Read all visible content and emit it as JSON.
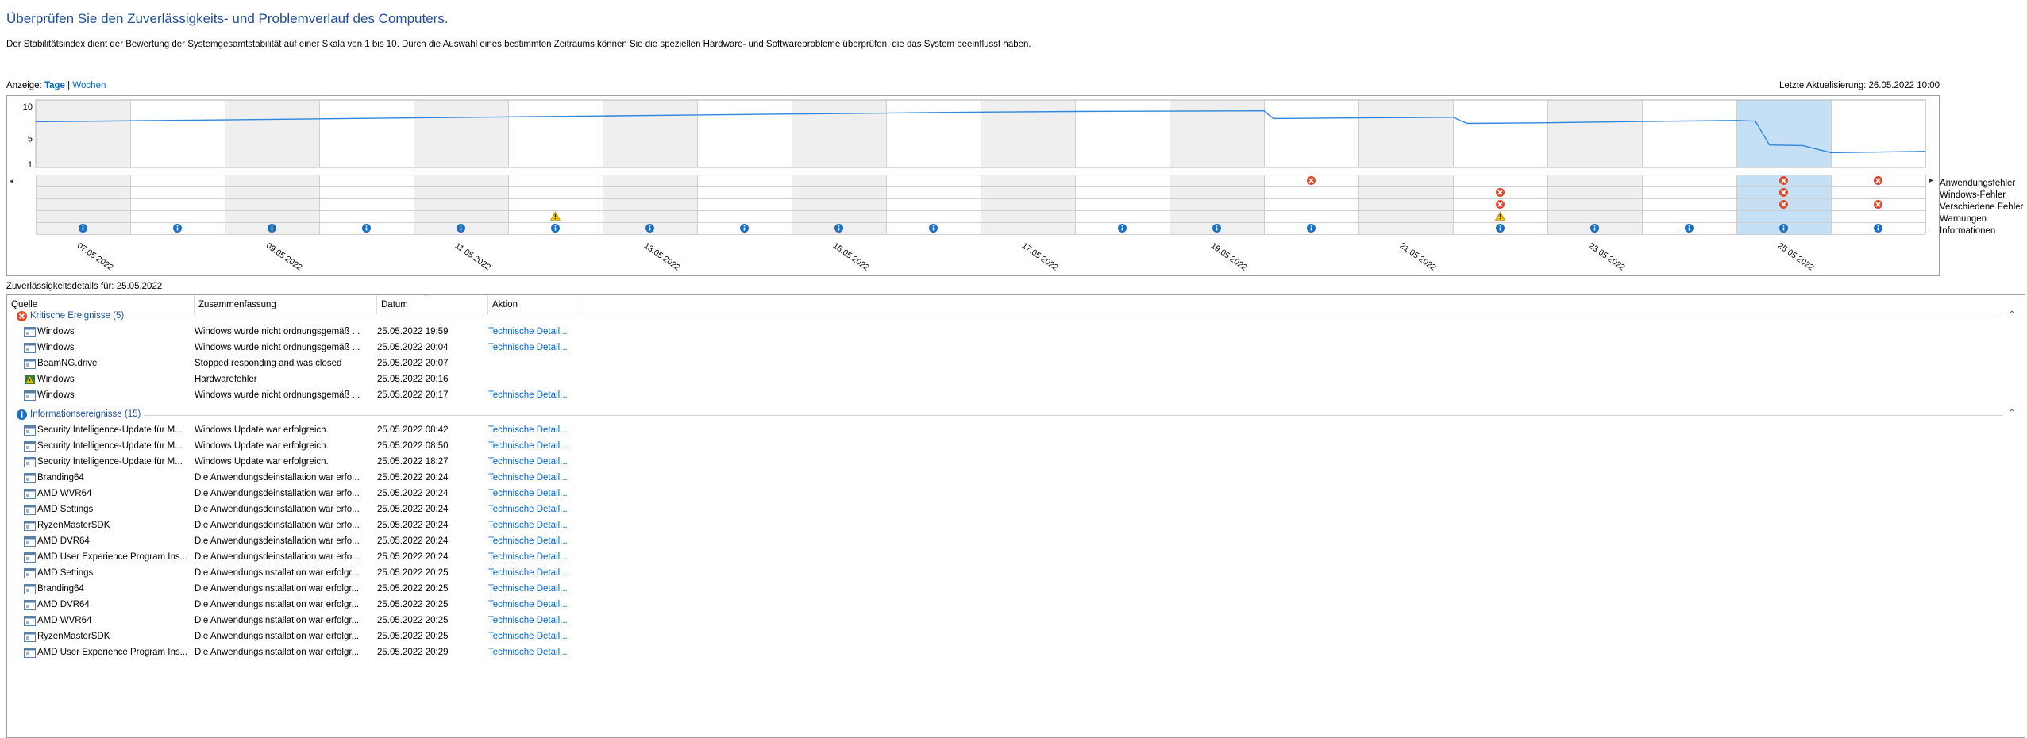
{
  "header": {
    "title": "Überprüfen Sie den Zuverlässigkeits- und Problemverlauf des Computers.",
    "description": "Der Stabilitätsindex dient der Bewertung der Systemgesamtstabilität auf einer Skala von 1 bis 10. Durch die Auswahl eines bestimmten Zeitraums können Sie die speziellen Hardware- und Softwareprobleme überprüfen, die das System beeinflusst haben.",
    "view_label": "Anzeige:",
    "view_days": "Tage",
    "view_separator": "|",
    "view_weeks": "Wochen",
    "last_update": "Letzte Aktualisierung: 26.05.2022 10:00"
  },
  "chart_data": {
    "type": "line",
    "y_ticks": [
      "10",
      "5",
      "1"
    ],
    "ylim": [
      1,
      10
    ],
    "x_labels": [
      "07.05.2022",
      "09.05.2022",
      "11.05.2022",
      "13.05.2022",
      "15.05.2022",
      "17.05.2022",
      "19.05.2022",
      "21.05.2022",
      "23.05.2022",
      "25.05.2022"
    ],
    "x_label_columns": [
      0,
      2,
      4,
      6,
      8,
      10,
      12,
      14,
      16,
      18
    ],
    "num_columns": 20,
    "selected_column": 18,
    "stability": {
      "x": [
        0,
        1,
        2,
        3,
        4,
        5,
        6,
        7,
        8,
        9,
        10,
        11,
        12,
        13,
        13.1,
        14,
        15,
        15.15,
        16,
        17,
        18,
        18.2,
        18.35,
        18.7,
        19,
        20
      ],
      "y": [
        7.6,
        7.75,
        7.9,
        8.05,
        8.2,
        8.35,
        8.5,
        8.65,
        8.8,
        8.95,
        9.1,
        9.2,
        9.25,
        9.3,
        8.1,
        8.2,
        8.3,
        7.35,
        7.45,
        7.65,
        7.8,
        7.7,
        4.0,
        3.9,
        2.8,
        3.0
      ]
    },
    "event_rows": [
      "Anwendungsfehler",
      "Windows-Fehler",
      "Verschiedene Fehler",
      "Warnungen",
      "Informationen"
    ],
    "events": {
      "Anwendungsfehler": [
        13,
        18,
        19
      ],
      "Windows-Fehler": [
        15,
        18
      ],
      "Verschiedene Fehler": [
        15,
        18,
        19
      ],
      "Warnungen": [
        5,
        15
      ],
      "Informationen": [
        0,
        1,
        2,
        3,
        4,
        5,
        6,
        7,
        8,
        9,
        11,
        12,
        13,
        15,
        16,
        17,
        18,
        19
      ]
    },
    "colors": {
      "line": "#2e86de",
      "weekend_fill": "#efefef",
      "selected_fill": "#c5e0f5",
      "error": "#e0492a",
      "warning": "#f2c200",
      "info": "#1b6fc2"
    }
  },
  "nav": {
    "left_arrow": "◂",
    "right_arrow": "▸"
  },
  "details": {
    "title": "Zuverlässigkeitsdetails für: 25.05.2022",
    "columns": [
      "Quelle",
      "Zusammenfassung",
      "Datum",
      "Aktion"
    ],
    "sort_indicator": "^",
    "collapse_glyph": "⌃",
    "groups": [
      {
        "label": "Kritische Ereignisse (5)",
        "icon": "error-icon",
        "rows": [
          {
            "source": "Windows",
            "summary": "Windows wurde nicht ordnungsgemäß ...",
            "date": "25.05.2022 19:59",
            "action": "Technische Detail...",
            "icon": "window-app-icon"
          },
          {
            "source": "Windows",
            "summary": "Windows wurde nicht ordnungsgemäß ...",
            "date": "25.05.2022 20:04",
            "action": "Technische Detail...",
            "icon": "window-app-icon"
          },
          {
            "source": "BeamNG.drive",
            "summary": "Stopped responding and was closed",
            "date": "25.05.2022 20:07",
            "action": "",
            "icon": "window-app-icon"
          },
          {
            "source": "Windows",
            "summary": "Hardwarefehler",
            "date": "25.05.2022 20:16",
            "action": "",
            "icon": "hardware-icon"
          },
          {
            "source": "Windows",
            "summary": "Windows wurde nicht ordnungsgemäß ...",
            "date": "25.05.2022 20:17",
            "action": "Technische Detail...",
            "icon": "window-app-icon"
          }
        ]
      },
      {
        "label": "Informationsereignisse (15)",
        "icon": "info-icon",
        "rows": [
          {
            "source": "Security Intelligence-Update für M...",
            "summary": "Windows Update war erfolgreich.",
            "date": "25.05.2022 08:42",
            "action": "Technische Detail...",
            "icon": "window-app-icon"
          },
          {
            "source": "Security Intelligence-Update für M...",
            "summary": "Windows Update war erfolgreich.",
            "date": "25.05.2022 08:50",
            "action": "Technische Detail...",
            "icon": "window-app-icon"
          },
          {
            "source": "Security Intelligence-Update für M...",
            "summary": "Windows Update war erfolgreich.",
            "date": "25.05.2022 18:27",
            "action": "Technische Detail...",
            "icon": "window-app-icon"
          },
          {
            "source": "Branding64",
            "summary": "Die Anwendungsdeinstallation war erfo...",
            "date": "25.05.2022 20:24",
            "action": "Technische Detail...",
            "icon": "window-app-icon"
          },
          {
            "source": "AMD WVR64",
            "summary": "Die Anwendungsdeinstallation war erfo...",
            "date": "25.05.2022 20:24",
            "action": "Technische Detail...",
            "icon": "window-app-icon"
          },
          {
            "source": "AMD Settings",
            "summary": "Die Anwendungsdeinstallation war erfo...",
            "date": "25.05.2022 20:24",
            "action": "Technische Detail...",
            "icon": "window-app-icon"
          },
          {
            "source": "RyzenMasterSDK",
            "summary": "Die Anwendungsdeinstallation war erfo...",
            "date": "25.05.2022 20:24",
            "action": "Technische Detail...",
            "icon": "window-app-icon"
          },
          {
            "source": "AMD DVR64",
            "summary": "Die Anwendungsdeinstallation war erfo...",
            "date": "25.05.2022 20:24",
            "action": "Technische Detail...",
            "icon": "window-app-icon"
          },
          {
            "source": "AMD User Experience Program Ins...",
            "summary": "Die Anwendungsdeinstallation war erfo...",
            "date": "25.05.2022 20:24",
            "action": "Technische Detail...",
            "icon": "window-app-icon"
          },
          {
            "source": "AMD Settings",
            "summary": "Die Anwendungsinstallation war erfolgr...",
            "date": "25.05.2022 20:25",
            "action": "Technische Detail...",
            "icon": "window-app-icon"
          },
          {
            "source": "Branding64",
            "summary": "Die Anwendungsinstallation war erfolgr...",
            "date": "25.05.2022 20:25",
            "action": "Technische Detail...",
            "icon": "window-app-icon"
          },
          {
            "source": "AMD DVR64",
            "summary": "Die Anwendungsinstallation war erfolgr...",
            "date": "25.05.2022 20:25",
            "action": "Technische Detail...",
            "icon": "window-app-icon"
          },
          {
            "source": "AMD WVR64",
            "summary": "Die Anwendungsinstallation war erfolgr...",
            "date": "25.05.2022 20:25",
            "action": "Technische Detail...",
            "icon": "window-app-icon"
          },
          {
            "source": "RyzenMasterSDK",
            "summary": "Die Anwendungsinstallation war erfolgr...",
            "date": "25.05.2022 20:25",
            "action": "Technische Detail...",
            "icon": "window-app-icon"
          },
          {
            "source": "AMD User Experience Program Ins...",
            "summary": "Die Anwendungsinstallation war erfolgr...",
            "date": "25.05.2022 20:29",
            "action": "Technische Detail...",
            "icon": "window-app-icon"
          }
        ]
      }
    ]
  }
}
